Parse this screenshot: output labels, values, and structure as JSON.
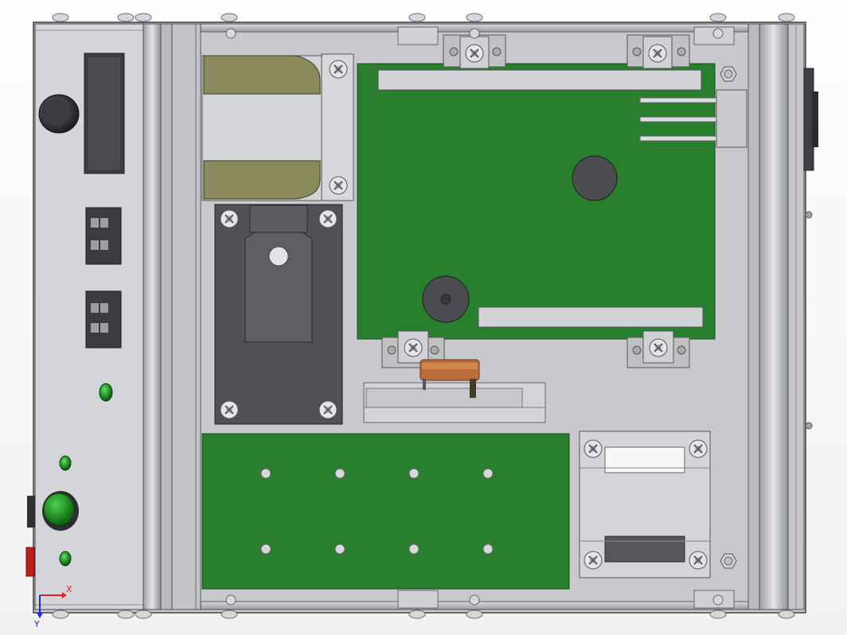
{
  "viewport": {
    "axis_triad": {
      "x_label": "X",
      "y_label": "Y"
    },
    "colors": {
      "pcb_green": "#2a7f2e",
      "sheet_metal": "#c6c8cd",
      "housing_grey": "#b7b9bd",
      "transformer_core": "#8a8a5c",
      "relay_black": "#4f5154",
      "resistor_brown": "#b96b3a",
      "led_green": "#1d8f22",
      "button_red": "#c11d1d",
      "axis_x": "#e0222a",
      "axis_y": "#1a2fd6"
    }
  }
}
